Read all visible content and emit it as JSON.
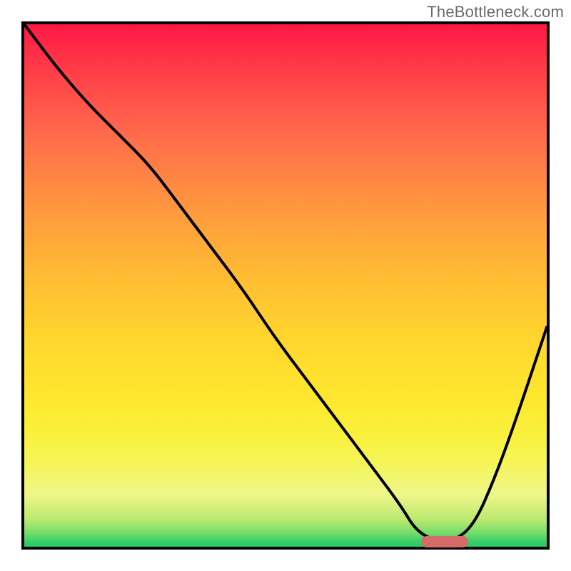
{
  "watermark": "TheBottleneck.com",
  "chart_data": {
    "type": "line",
    "title": "",
    "xlabel": "",
    "ylabel": "",
    "xlim": [
      0,
      100
    ],
    "ylim": [
      0,
      100
    ],
    "grid": false,
    "legend": false,
    "x": [
      0,
      6,
      12,
      18,
      24,
      30,
      36,
      42,
      48,
      54,
      60,
      66,
      72,
      75,
      79,
      82,
      86,
      90,
      94,
      100
    ],
    "y": [
      100,
      92,
      85,
      79,
      73,
      65,
      57,
      49,
      40,
      32,
      24,
      16,
      8,
      3,
      1,
      1,
      4,
      13,
      24,
      42
    ],
    "marker": {
      "x_center": 80.5,
      "x_width": 9,
      "y": 1
    }
  },
  "colors": {
    "curve": "#000000",
    "marker": "#d66a6a",
    "border": "#000000"
  }
}
